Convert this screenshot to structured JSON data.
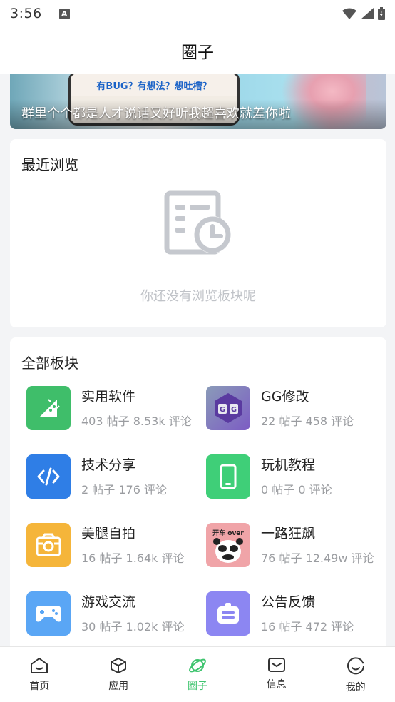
{
  "status_bar": {
    "time": "3:56",
    "notification_badge": "A"
  },
  "header": {
    "title": "圈子"
  },
  "banner": {
    "card_text": "有BUG？有想法？想吐槽？",
    "caption": "群里个个都是人才说话又好听我超喜欢就差你啦"
  },
  "recent": {
    "title": "最近浏览",
    "empty_text": "你还没有浏览板块呢",
    "empty_icon": "document-clock-icon"
  },
  "all_boards": {
    "title": "全部板块",
    "items": [
      {
        "name": "实用软件",
        "stats": "403 帖子 8.53k 评论",
        "icon": "android-icon",
        "color": "#3fbe6a"
      },
      {
        "name": "GG修改",
        "stats": "22 帖子 458 评论",
        "icon": "gg-logo-icon",
        "color": "#7c5cc4"
      },
      {
        "name": "技术分享",
        "stats": "2 帖子 176 评论",
        "icon": "code-icon",
        "color": "#2f7ee6"
      },
      {
        "name": "玩机教程",
        "stats": "0 帖子 0 评论",
        "icon": "phone-icon",
        "color": "#3fcf78"
      },
      {
        "name": "美腿自拍",
        "stats": "16 帖子 1.64k 评论",
        "icon": "camera-icon",
        "color": "#f5b53a"
      },
      {
        "name": "一路狂飙",
        "stats": "76 帖子 12.49w 评论",
        "icon": "panda-meme-icon",
        "color": "#f0a4a8",
        "icon_text": "开车 over"
      },
      {
        "name": "游戏交流",
        "stats": "30 帖子 1.02k 评论",
        "icon": "gamepad-icon",
        "color": "#5aa6f5"
      },
      {
        "name": "公告反馈",
        "stats": "16 帖子 472 评论",
        "icon": "feedback-icon",
        "color": "#8c86f2"
      }
    ]
  },
  "bottom_nav": {
    "active": "圈子",
    "accent": "#3fc46f",
    "items": [
      {
        "label": "首页",
        "icon": "home-icon"
      },
      {
        "label": "应用",
        "icon": "cube-icon"
      },
      {
        "label": "圈子",
        "icon": "planet-icon"
      },
      {
        "label": "信息",
        "icon": "mail-icon"
      },
      {
        "label": "我的",
        "icon": "smile-icon"
      }
    ]
  }
}
